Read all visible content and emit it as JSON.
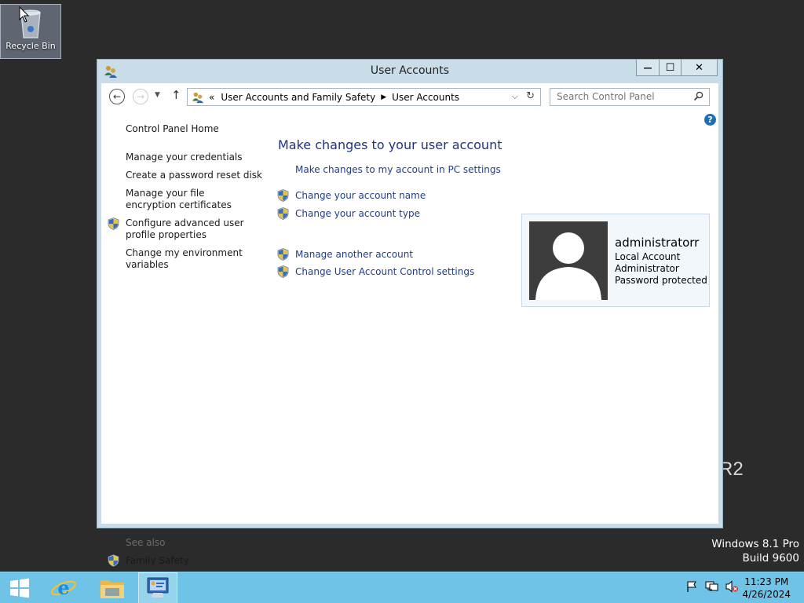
{
  "desktop": {
    "recycle_bin_label": "Recycle Bin",
    "edition_watermark": "R2",
    "os_name": "Windows 8.1 Pro",
    "os_build": "Build 9600"
  },
  "window": {
    "title": "User Accounts",
    "controls": {
      "minimize": "—",
      "maximize": "☐",
      "close": "✕"
    }
  },
  "toolbar": {
    "address_prefix": "«",
    "breadcrumb": [
      "User Accounts and Family Safety",
      "User Accounts"
    ],
    "search_placeholder": "Search Control Panel"
  },
  "left_pane": {
    "home": "Control Panel Home",
    "links": [
      "Manage your credentials",
      "Create a password reset disk",
      "Manage your file encryption certificates",
      "Configure advanced user profile properties",
      "Change my environment variables"
    ],
    "see_also_label": "See also",
    "see_also_links": [
      "Family Safety"
    ]
  },
  "main": {
    "heading": "Make changes to your user account",
    "pc_settings_link": "Make changes to my account in PC settings",
    "tasks": [
      "Change your account name",
      "Change your account type",
      "Manage another account",
      "Change User Account Control settings"
    ]
  },
  "account": {
    "name": "administratorr",
    "type": "Local Account",
    "role": "Administrator",
    "security": "Password protected"
  },
  "taskbar": {
    "time": "11:23 PM",
    "date": "4/26/2024"
  },
  "colors": {
    "link": "#1e3d8f",
    "heading": "#1e3287",
    "taskbar": "#6ec3e6",
    "window_frame": "#c9dde8"
  }
}
